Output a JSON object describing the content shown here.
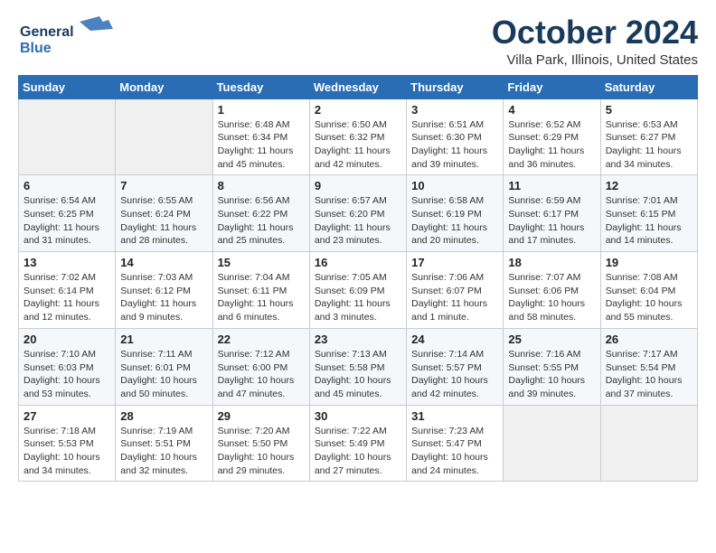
{
  "header": {
    "logo_general": "General",
    "logo_blue": "Blue",
    "month_title": "October 2024",
    "location": "Villa Park, Illinois, United States"
  },
  "days_of_week": [
    "Sunday",
    "Monday",
    "Tuesday",
    "Wednesday",
    "Thursday",
    "Friday",
    "Saturday"
  ],
  "weeks": [
    [
      {
        "day": "",
        "sunrise": "",
        "sunset": "",
        "daylight": "",
        "empty": true
      },
      {
        "day": "",
        "sunrise": "",
        "sunset": "",
        "daylight": "",
        "empty": true
      },
      {
        "day": "1",
        "sunrise": "Sunrise: 6:48 AM",
        "sunset": "Sunset: 6:34 PM",
        "daylight": "Daylight: 11 hours and 45 minutes."
      },
      {
        "day": "2",
        "sunrise": "Sunrise: 6:50 AM",
        "sunset": "Sunset: 6:32 PM",
        "daylight": "Daylight: 11 hours and 42 minutes."
      },
      {
        "day": "3",
        "sunrise": "Sunrise: 6:51 AM",
        "sunset": "Sunset: 6:30 PM",
        "daylight": "Daylight: 11 hours and 39 minutes."
      },
      {
        "day": "4",
        "sunrise": "Sunrise: 6:52 AM",
        "sunset": "Sunset: 6:29 PM",
        "daylight": "Daylight: 11 hours and 36 minutes."
      },
      {
        "day": "5",
        "sunrise": "Sunrise: 6:53 AM",
        "sunset": "Sunset: 6:27 PM",
        "daylight": "Daylight: 11 hours and 34 minutes."
      }
    ],
    [
      {
        "day": "6",
        "sunrise": "Sunrise: 6:54 AM",
        "sunset": "Sunset: 6:25 PM",
        "daylight": "Daylight: 11 hours and 31 minutes."
      },
      {
        "day": "7",
        "sunrise": "Sunrise: 6:55 AM",
        "sunset": "Sunset: 6:24 PM",
        "daylight": "Daylight: 11 hours and 28 minutes."
      },
      {
        "day": "8",
        "sunrise": "Sunrise: 6:56 AM",
        "sunset": "Sunset: 6:22 PM",
        "daylight": "Daylight: 11 hours and 25 minutes."
      },
      {
        "day": "9",
        "sunrise": "Sunrise: 6:57 AM",
        "sunset": "Sunset: 6:20 PM",
        "daylight": "Daylight: 11 hours and 23 minutes."
      },
      {
        "day": "10",
        "sunrise": "Sunrise: 6:58 AM",
        "sunset": "Sunset: 6:19 PM",
        "daylight": "Daylight: 11 hours and 20 minutes."
      },
      {
        "day": "11",
        "sunrise": "Sunrise: 6:59 AM",
        "sunset": "Sunset: 6:17 PM",
        "daylight": "Daylight: 11 hours and 17 minutes."
      },
      {
        "day": "12",
        "sunrise": "Sunrise: 7:01 AM",
        "sunset": "Sunset: 6:15 PM",
        "daylight": "Daylight: 11 hours and 14 minutes."
      }
    ],
    [
      {
        "day": "13",
        "sunrise": "Sunrise: 7:02 AM",
        "sunset": "Sunset: 6:14 PM",
        "daylight": "Daylight: 11 hours and 12 minutes."
      },
      {
        "day": "14",
        "sunrise": "Sunrise: 7:03 AM",
        "sunset": "Sunset: 6:12 PM",
        "daylight": "Daylight: 11 hours and 9 minutes."
      },
      {
        "day": "15",
        "sunrise": "Sunrise: 7:04 AM",
        "sunset": "Sunset: 6:11 PM",
        "daylight": "Daylight: 11 hours and 6 minutes."
      },
      {
        "day": "16",
        "sunrise": "Sunrise: 7:05 AM",
        "sunset": "Sunset: 6:09 PM",
        "daylight": "Daylight: 11 hours and 3 minutes."
      },
      {
        "day": "17",
        "sunrise": "Sunrise: 7:06 AM",
        "sunset": "Sunset: 6:07 PM",
        "daylight": "Daylight: 11 hours and 1 minute."
      },
      {
        "day": "18",
        "sunrise": "Sunrise: 7:07 AM",
        "sunset": "Sunset: 6:06 PM",
        "daylight": "Daylight: 10 hours and 58 minutes."
      },
      {
        "day": "19",
        "sunrise": "Sunrise: 7:08 AM",
        "sunset": "Sunset: 6:04 PM",
        "daylight": "Daylight: 10 hours and 55 minutes."
      }
    ],
    [
      {
        "day": "20",
        "sunrise": "Sunrise: 7:10 AM",
        "sunset": "Sunset: 6:03 PM",
        "daylight": "Daylight: 10 hours and 53 minutes."
      },
      {
        "day": "21",
        "sunrise": "Sunrise: 7:11 AM",
        "sunset": "Sunset: 6:01 PM",
        "daylight": "Daylight: 10 hours and 50 minutes."
      },
      {
        "day": "22",
        "sunrise": "Sunrise: 7:12 AM",
        "sunset": "Sunset: 6:00 PM",
        "daylight": "Daylight: 10 hours and 47 minutes."
      },
      {
        "day": "23",
        "sunrise": "Sunrise: 7:13 AM",
        "sunset": "Sunset: 5:58 PM",
        "daylight": "Daylight: 10 hours and 45 minutes."
      },
      {
        "day": "24",
        "sunrise": "Sunrise: 7:14 AM",
        "sunset": "Sunset: 5:57 PM",
        "daylight": "Daylight: 10 hours and 42 minutes."
      },
      {
        "day": "25",
        "sunrise": "Sunrise: 7:16 AM",
        "sunset": "Sunset: 5:55 PM",
        "daylight": "Daylight: 10 hours and 39 minutes."
      },
      {
        "day": "26",
        "sunrise": "Sunrise: 7:17 AM",
        "sunset": "Sunset: 5:54 PM",
        "daylight": "Daylight: 10 hours and 37 minutes."
      }
    ],
    [
      {
        "day": "27",
        "sunrise": "Sunrise: 7:18 AM",
        "sunset": "Sunset: 5:53 PM",
        "daylight": "Daylight: 10 hours and 34 minutes."
      },
      {
        "day": "28",
        "sunrise": "Sunrise: 7:19 AM",
        "sunset": "Sunset: 5:51 PM",
        "daylight": "Daylight: 10 hours and 32 minutes."
      },
      {
        "day": "29",
        "sunrise": "Sunrise: 7:20 AM",
        "sunset": "Sunset: 5:50 PM",
        "daylight": "Daylight: 10 hours and 29 minutes."
      },
      {
        "day": "30",
        "sunrise": "Sunrise: 7:22 AM",
        "sunset": "Sunset: 5:49 PM",
        "daylight": "Daylight: 10 hours and 27 minutes."
      },
      {
        "day": "31",
        "sunrise": "Sunrise: 7:23 AM",
        "sunset": "Sunset: 5:47 PM",
        "daylight": "Daylight: 10 hours and 24 minutes."
      },
      {
        "day": "",
        "sunrise": "",
        "sunset": "",
        "daylight": "",
        "empty": true
      },
      {
        "day": "",
        "sunrise": "",
        "sunset": "",
        "daylight": "",
        "empty": true
      }
    ]
  ]
}
